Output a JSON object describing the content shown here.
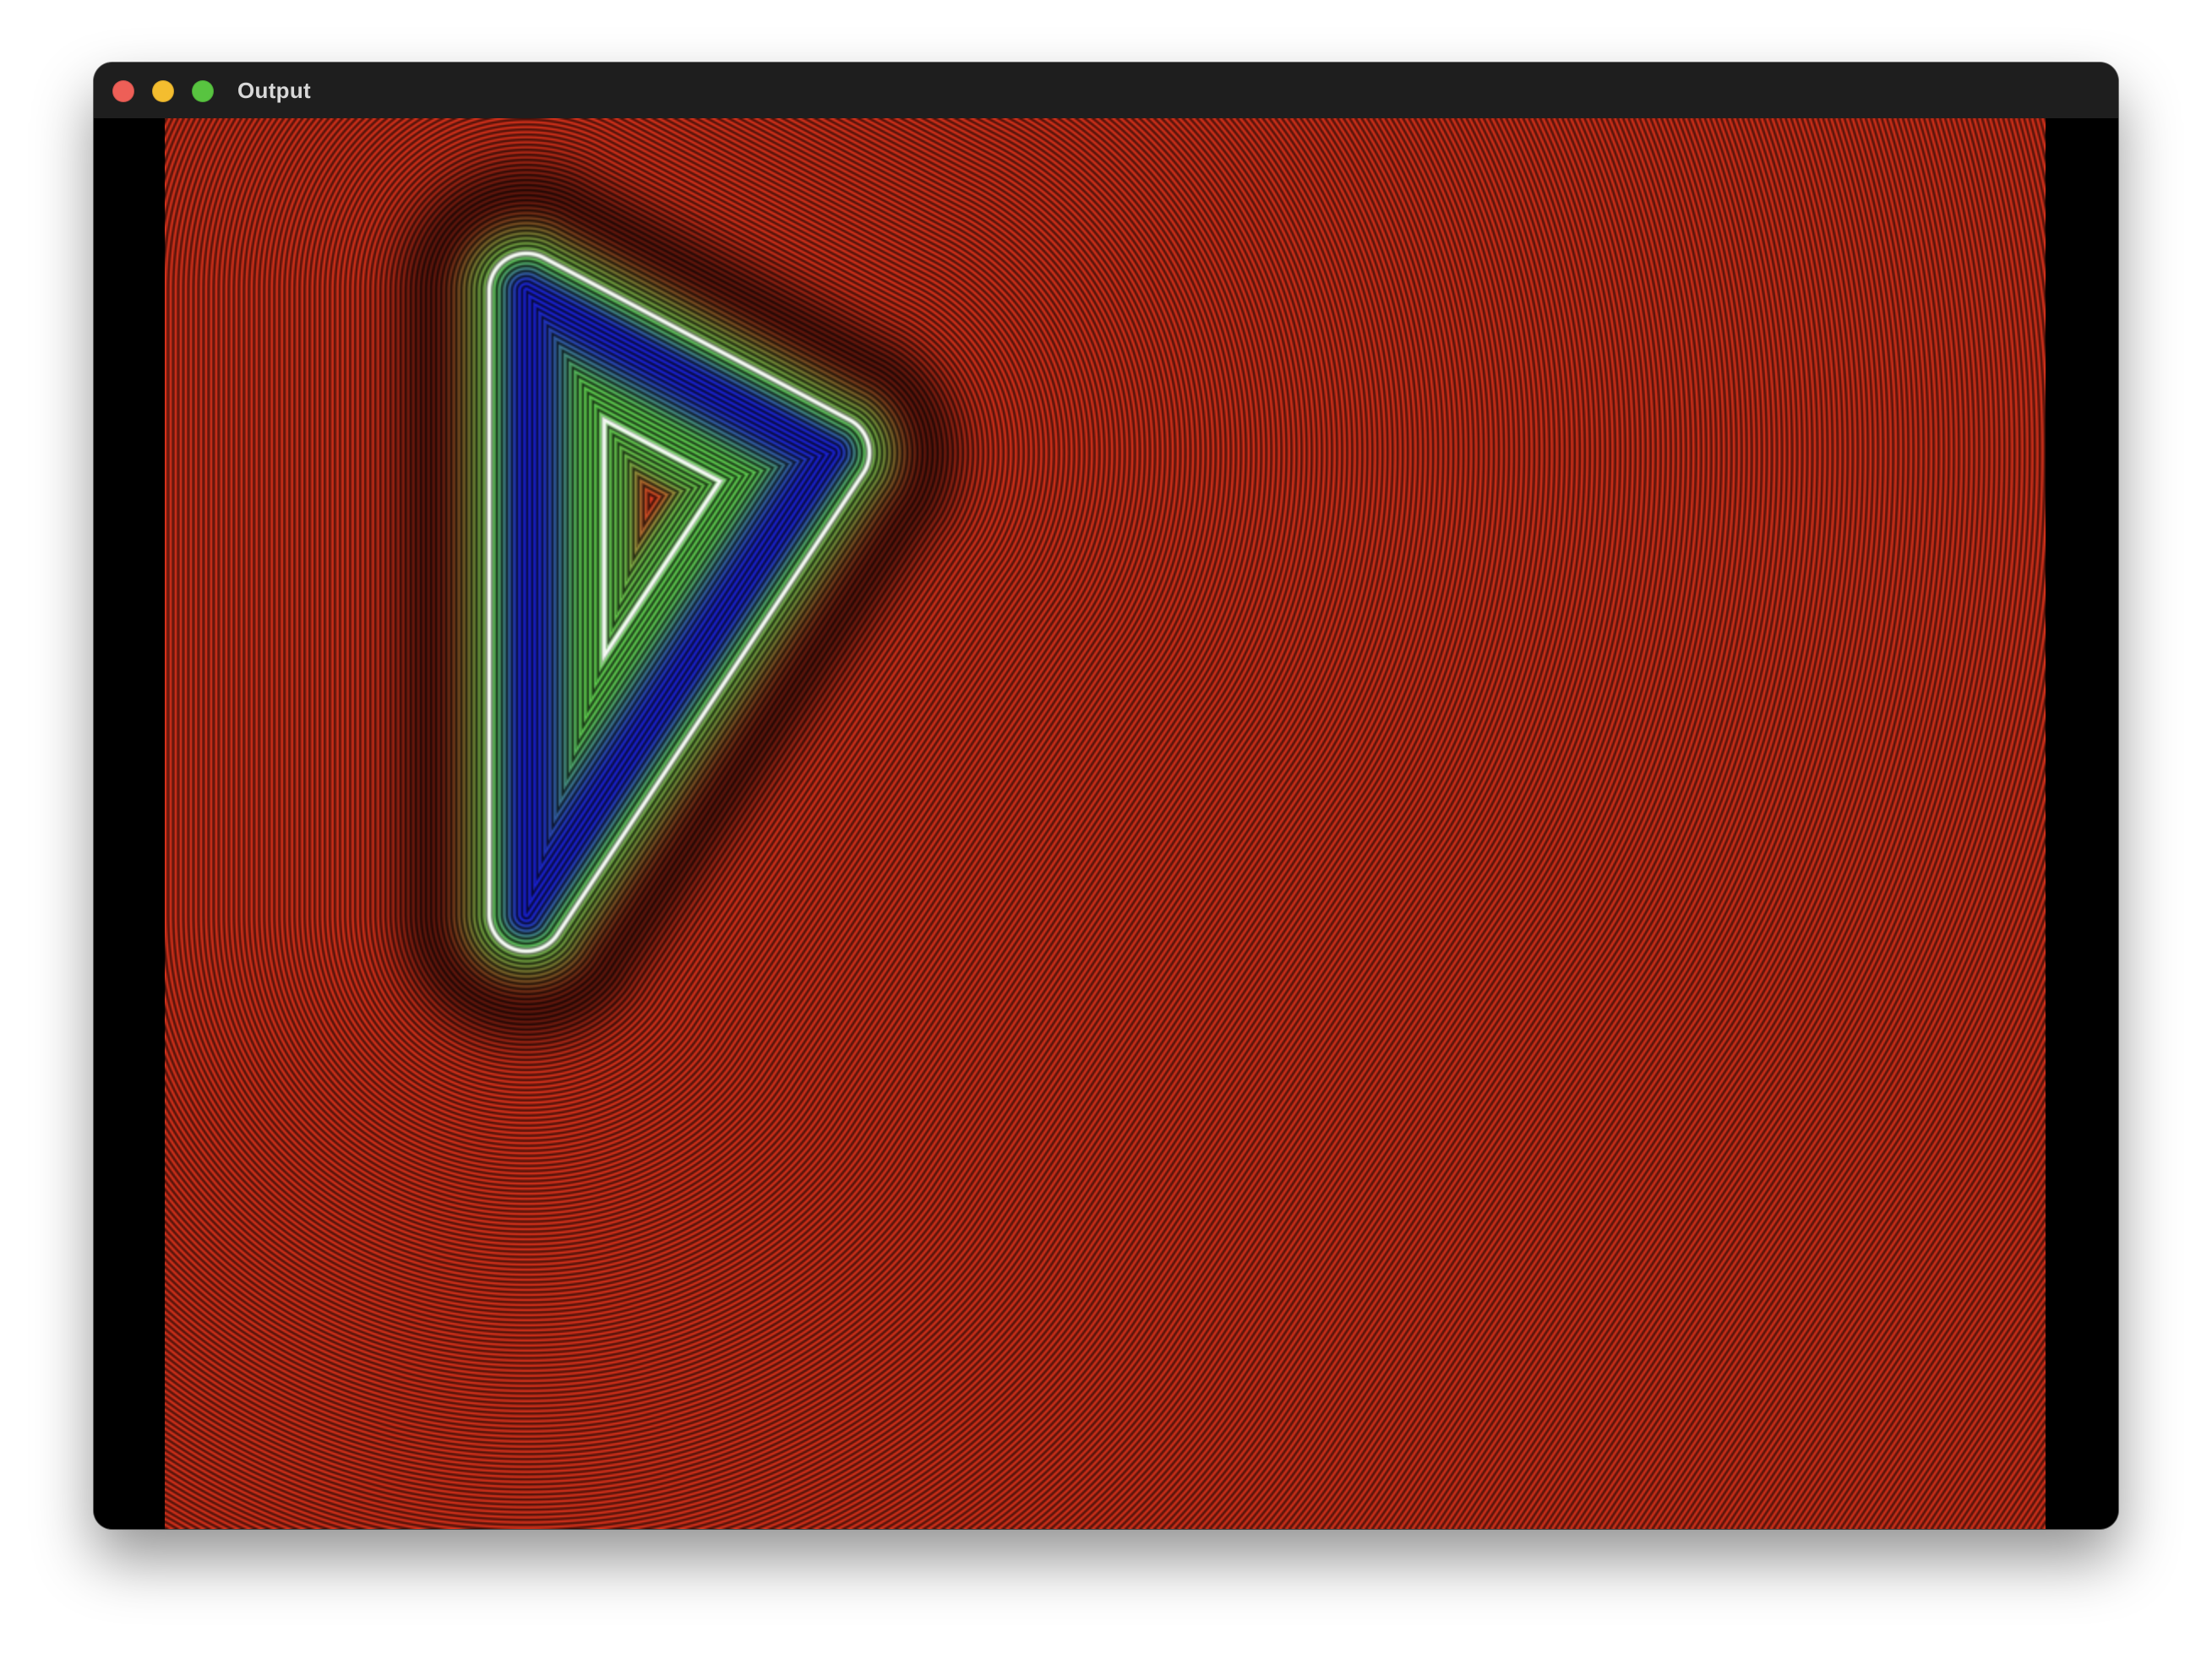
{
  "window": {
    "title": "Output",
    "controls": [
      "close",
      "minimize",
      "maximize"
    ],
    "control_icons": [
      "close-icon",
      "minimize-icon",
      "maximize-icon"
    ],
    "control_colors": [
      "#ee5f57",
      "#f4bd2f",
      "#58c440"
    ]
  },
  "render": {
    "kind": "signed distance field contour visualization",
    "shape": "rounded triangle (play symbol)",
    "colors": {
      "outside": "#e0341c",
      "inside_ring": "#1a22d8",
      "boundary": "#ffffff",
      "transition": "#5fcf4f",
      "band_dark": "#000000"
    }
  }
}
